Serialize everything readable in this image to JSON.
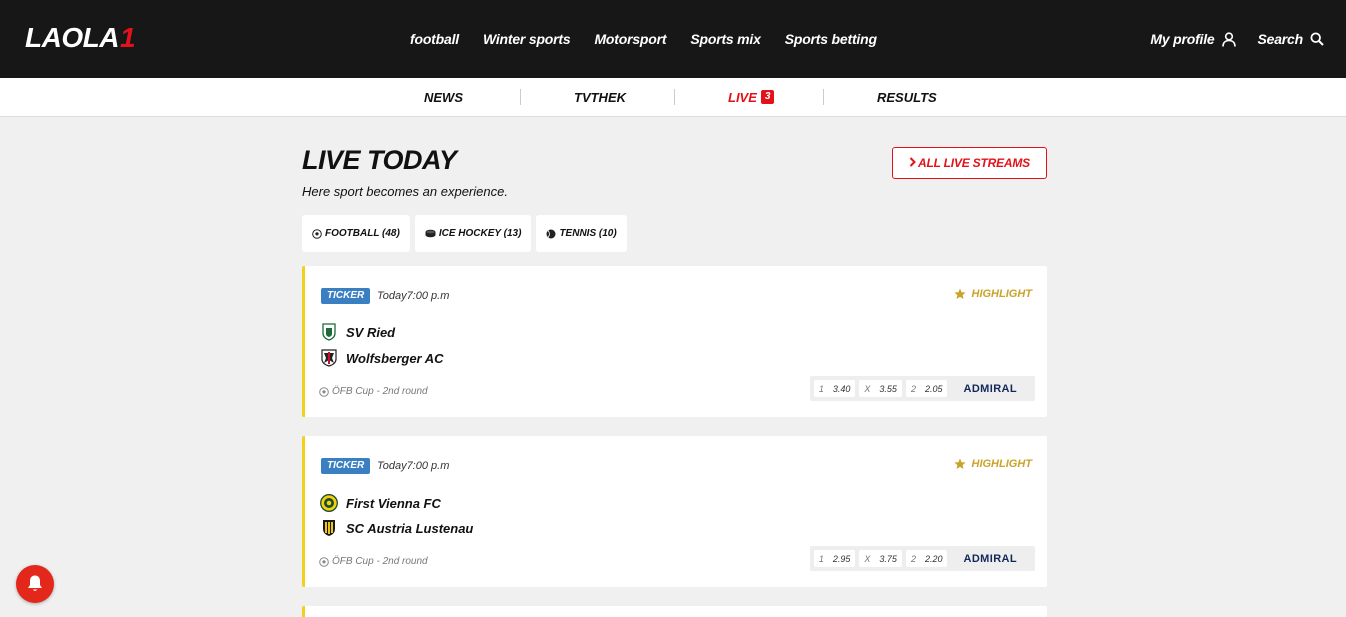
{
  "header": {
    "logo_main": "LAOLA",
    "logo_accent": "1",
    "nav": [
      "football",
      "Winter sports",
      "Motorsport",
      "Sports mix",
      "Sports betting"
    ],
    "profile_label": "My profile",
    "search_label": "Search"
  },
  "subnav": {
    "news": "NEWS",
    "tvthek": "TVTHEK",
    "live": "LIVE",
    "live_count": "3",
    "results": "RESULTS"
  },
  "page": {
    "title": "LIVE TODAY",
    "subtitle": "Here sport becomes an experience.",
    "all_streams": "ALL LIVE STREAMS"
  },
  "filters": [
    {
      "label": "FOOTBALL (48)",
      "icon": "soccer-ball-icon"
    },
    {
      "label": "ICE HOCKEY (13)",
      "icon": "hockey-puck-icon"
    },
    {
      "label": "TENNIS (10)",
      "icon": "tennis-ball-icon"
    }
  ],
  "matches": [
    {
      "badge": "TICKER",
      "time": "Today7:00 p.m",
      "highlight": "HIGHLIGHT",
      "home": "SV Ried",
      "away": "Wolfsberger AC",
      "competition": "ÖFB Cup - 2nd round",
      "odds": [
        {
          "k": "1",
          "v": "3.40"
        },
        {
          "k": "X",
          "v": "3.55"
        },
        {
          "k": "2",
          "v": "2.05"
        }
      ],
      "bookmaker": "ADMIRAL"
    },
    {
      "badge": "TICKER",
      "time": "Today7:00 p.m",
      "highlight": "HIGHLIGHT",
      "home": "First Vienna FC",
      "away": "SC Austria Lustenau",
      "competition": "ÖFB Cup - 2nd round",
      "odds": [
        {
          "k": "1",
          "v": "2.95"
        },
        {
          "k": "X",
          "v": "3.75"
        },
        {
          "k": "2",
          "v": "2.20"
        }
      ],
      "bookmaker": "ADMIRAL"
    }
  ],
  "colors": {
    "brand_red": "#e2121b",
    "highlight_gold": "#c9a32a",
    "ticker_blue": "#3a7fc1",
    "card_accent": "#f2d01b"
  }
}
